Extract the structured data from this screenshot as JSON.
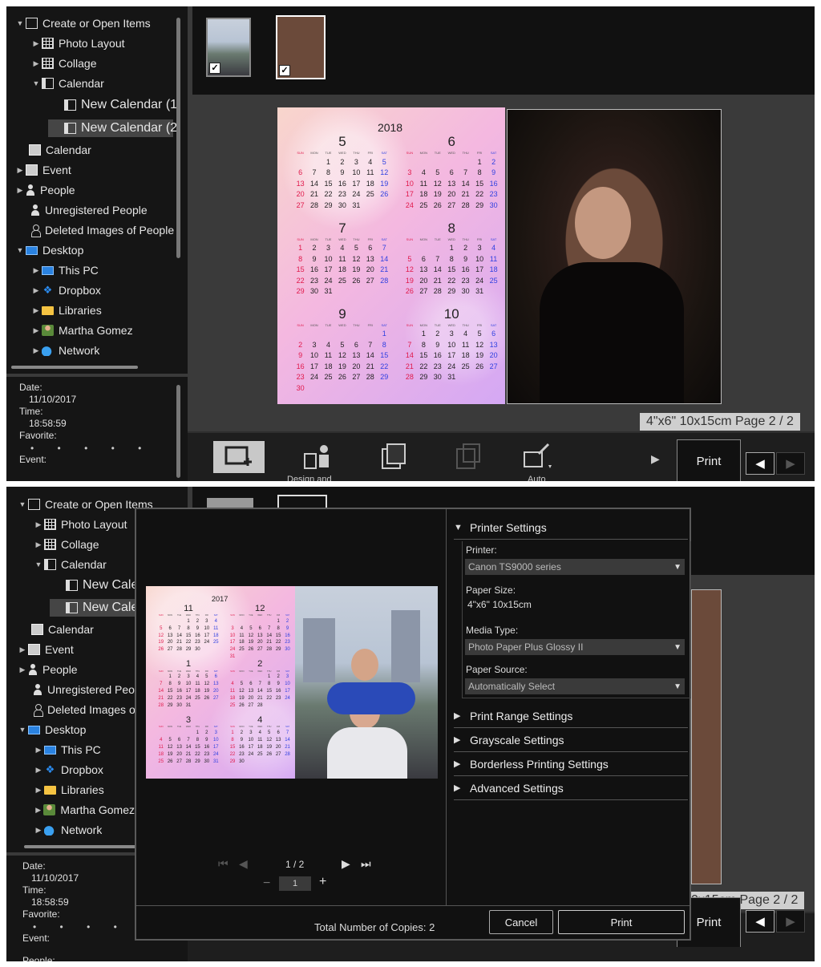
{
  "tree": {
    "create_open": "Create or Open Items",
    "photo_layout": "Photo Layout",
    "collage": "Collage",
    "calendar_node": "Calendar",
    "new_calendar_1": "New Calendar (1",
    "new_calendar_2": "New Calendar (2",
    "calendar": "Calendar",
    "event": "Event",
    "people": "People",
    "unregistered": "Unregistered People",
    "deleted": "Deleted Images of People",
    "desktop": "Desktop",
    "this_pc": "This PC",
    "dropbox": "Dropbox",
    "libraries": "Libraries",
    "user": "Martha Gomez",
    "network": "Network",
    "new_calendar_short": "New Cale",
    "unregistered_short": "Unregistered Peop",
    "deleted_short": "Deleted Images of",
    "user_short": "Martha Gomez"
  },
  "info": {
    "date_label": "Date:",
    "date_value": "11/10/2017",
    "time_label": "Time:",
    "time_value": "18:58:59",
    "favorite_label": "Favorite:",
    "favorite_stars": "• • • • •",
    "event_label": "Event:",
    "people_label": "People:",
    "favorite_rating": 0
  },
  "toolbar": {
    "design_label": "Design and",
    "auto_label": "Auto",
    "add_label": "Add",
    "print_label": "Print",
    "page_label": "4\"x6\" 10x15cm Page 2 / 2",
    "page_label_cut": "0x15cm Page 2 / 2"
  },
  "calendar_a": {
    "year": "2018",
    "weekdays": [
      "SUN",
      "MON",
      "TUE",
      "WED",
      "THU",
      "FRI",
      "SAT"
    ],
    "months": [
      {
        "num": "5",
        "start": 2,
        "days": 31
      },
      {
        "num": "6",
        "start": 5,
        "days": 30
      },
      {
        "num": "7",
        "start": 0,
        "days": 31
      },
      {
        "num": "8",
        "start": 3,
        "days": 31
      },
      {
        "num": "9",
        "start": 6,
        "days": 30
      },
      {
        "num": "10",
        "start": 1,
        "days": 31
      }
    ]
  },
  "calendar_b": {
    "year": "2017",
    "weekdays": [
      "SUN",
      "MON",
      "TUE",
      "WED",
      "THU",
      "FRI",
      "SAT"
    ],
    "months": [
      {
        "num": "11",
        "start": 3,
        "days": 30
      },
      {
        "num": "12",
        "start": 5,
        "days": 31
      },
      {
        "num": "1",
        "start": 1,
        "days": 31
      },
      {
        "num": "2",
        "start": 4,
        "days": 28
      },
      {
        "num": "3",
        "start": 4,
        "days": 31
      },
      {
        "num": "4",
        "start": 0,
        "days": 30
      }
    ]
  },
  "dialog": {
    "printer_settings": "Printer Settings",
    "printer_label": "Printer:",
    "printer_value": "Canon TS9000 series",
    "paper_size_label": "Paper Size:",
    "paper_size_value": "4\"x6\" 10x15cm",
    "media_type_label": "Media Type:",
    "media_type_value": "Photo Paper Plus Glossy II",
    "paper_source_label": "Paper Source:",
    "paper_source_value": "Automatically Select",
    "print_range": "Print Range Settings",
    "grayscale": "Grayscale Settings",
    "borderless": "Borderless Printing Settings",
    "advanced": "Advanced Settings",
    "page_indicator": "1 / 2",
    "page_input": "1",
    "copies_label": "Total Number of Copies:",
    "copies_value": "2",
    "cancel": "Cancel",
    "print": "Print"
  },
  "colors": {
    "sunday": "#e0184a",
    "saturday": "#3040e0",
    "panel_bg": "#111111",
    "selection": "#454545"
  }
}
